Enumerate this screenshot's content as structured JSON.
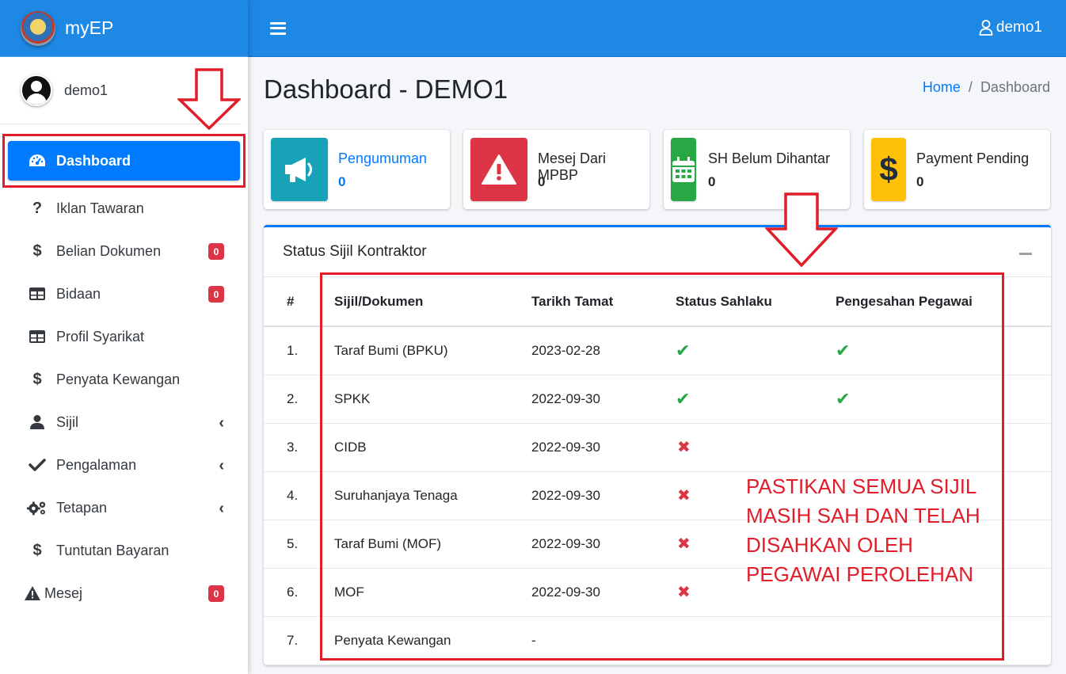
{
  "app": {
    "brand": "myEP",
    "user": "demo1"
  },
  "sidebar": {
    "items": [
      {
        "label": "Dashboard",
        "icon": "tachometer-icon",
        "active": true
      },
      {
        "label": "Iklan Tawaran",
        "icon": "question-icon"
      },
      {
        "label": "Belian Dokumen",
        "icon": "dollar-icon",
        "badge": "0"
      },
      {
        "label": "Bidaan",
        "icon": "table-icon",
        "badge": "0"
      },
      {
        "label": "Profil Syarikat",
        "icon": "table-icon"
      },
      {
        "label": "Penyata Kewangan",
        "icon": "dollar-icon"
      },
      {
        "label": "Sijil",
        "icon": "user-icon",
        "has_submenu": true
      },
      {
        "label": "Pengalaman",
        "icon": "check-icon",
        "has_submenu": true
      },
      {
        "label": "Tetapan",
        "icon": "cogs-icon",
        "has_submenu": true
      },
      {
        "label": "Tuntutan Bayaran",
        "icon": "dollar-icon"
      },
      {
        "label": "Mesej",
        "icon": "warning-icon",
        "badge": "0"
      }
    ]
  },
  "header": {
    "title": "Dashboard - DEMO1",
    "breadcrumb": [
      "Home",
      "Dashboard"
    ],
    "breadcrumb_sep": "/"
  },
  "info_boxes": [
    {
      "label": "Pengumuman",
      "value": "0",
      "icon": "bullhorn-icon",
      "color": "#17a2b8"
    },
    {
      "label": "Mesej Dari MPBP",
      "value": "0",
      "icon": "exclamation-triangle-icon",
      "color": "#dc3545"
    },
    {
      "label": "SH Belum Dihantar",
      "value": "0",
      "icon": "calendar-icon",
      "color": "#28a745"
    },
    {
      "label": "Payment Pending",
      "value": "0",
      "icon": "dollar-icon",
      "color": "#ffc107"
    }
  ],
  "status_card": {
    "title": "Status Sijil Kontraktor",
    "columns": [
      "#",
      "Sijil/Dokumen",
      "Tarikh Tamat",
      "Status Sahlaku",
      "Pengesahan Pegawai"
    ],
    "rows": [
      {
        "no": "1.",
        "doc": "Taraf Bumi (BPKU)",
        "date": "2023-02-28",
        "status": "valid",
        "verified": true
      },
      {
        "no": "2.",
        "doc": "SPKK",
        "date": "2022-09-30",
        "status": "valid",
        "verified": true
      },
      {
        "no": "3.",
        "doc": "CIDB",
        "date": "2022-09-30",
        "status": "invalid",
        "verified": false
      },
      {
        "no": "4.",
        "doc": "Suruhanjaya Tenaga",
        "date": "2022-09-30",
        "status": "invalid",
        "verified": false
      },
      {
        "no": "5.",
        "doc": "Taraf Bumi (MOF)",
        "date": "2022-09-30",
        "status": "invalid",
        "verified": false
      },
      {
        "no": "6.",
        "doc": "MOF",
        "date": "2022-09-30",
        "status": "invalid",
        "verified": false
      },
      {
        "no": "7.",
        "doc": "Penyata Kewangan",
        "date": "-",
        "status": "none",
        "verified": false
      }
    ]
  },
  "annotation": {
    "text": "PASTIKAN SEMUA SIJIL\nMASIH SAH DAN TELAH\nDISAHKAN OLEH\nPEGAWAI PEROLEHAN",
    "color": "#e11d2a"
  },
  "colors": {
    "primary": "#007bff",
    "topbar": "#1e88e5",
    "success": "#28a745",
    "danger": "#dc3545"
  }
}
